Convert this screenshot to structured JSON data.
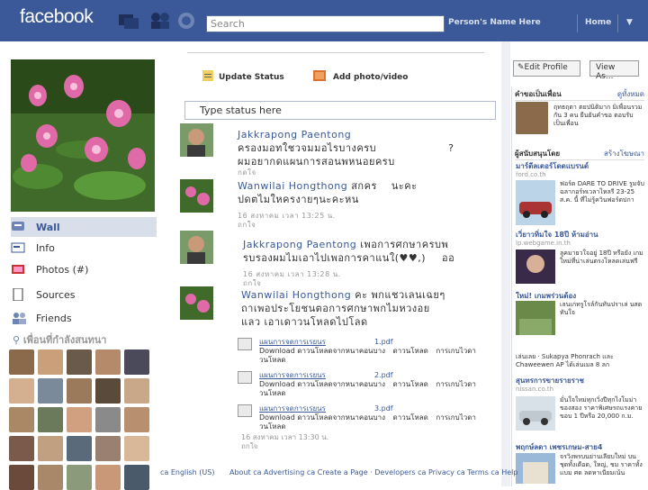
{
  "header": {
    "logo": "facebook",
    "search_placeholder": "Search",
    "user_name": "Person's Name Here",
    "home": "Home",
    "menu_arrow": "▼"
  },
  "profile": {
    "edit_profile": "Edit Profile",
    "view_as": "View As..."
  },
  "nav": {
    "items": [
      {
        "label": "Wall",
        "icon": "wall-icon"
      },
      {
        "label": "Info",
        "icon": "info-icon"
      },
      {
        "label": "Photos (#)",
        "icon": "photos-icon"
      },
      {
        "label": "Sources",
        "icon": "sources-icon"
      },
      {
        "label": "Friends",
        "icon": "friends-icon"
      }
    ],
    "friends_title": "เพื่อนที่กำลังสนทนา"
  },
  "publisher": {
    "update_status": "Update Status",
    "add_photo": "Add photo/video",
    "status_placeholder": "Type status here"
  },
  "posts": [
    {
      "author": "Jakkrapong Paentong",
      "line1": "ครองมอทใชวจมมอไรบางครบ",
      "line1b": "?",
      "line2": "ผมอยากดแผนการสอนพหนอยครบ",
      "meta": "กดใจ"
    },
    {
      "author": "Wanwilai Hongthong",
      "text1": "สกคร",
      "text1b": "นะคะ",
      "line2": "ปดตไมใหครงายๆนะคะหน",
      "meta": "16 สงหาคม เวลา 13:25 น.",
      "meta2": "ถกใจ"
    },
    {
      "author": "Jakkrapong Paentong",
      "text1": "เพอการศกษาครบพ",
      "line2": "รบรองผมไมเอาไปเพอการคาแนใ(♥♥,)",
      "line2b": "ออ",
      "meta": "16 สงหาคม เวลา 13:28 น.",
      "meta2": "ถกใจ"
    },
    {
      "author": "Wanwilai Hongthong",
      "text1": "คะ พกแชวเลนเฉยๆ",
      "line2": "ถาเพอประโยชนตอการศกษาพกไมหวงอย",
      "line3": "แลว เอาเดาวนโหลดไปโลด",
      "meta": "16 สงหาคม เวลา 13:30 น.",
      "meta2": "ถกใจ"
    }
  ],
  "files": [
    {
      "name": "แผนการจดการเรยนร",
      "suffix": "1.pdf",
      "download": "Download",
      "from": "ดาวนโหลดจากหนาคอนบาง",
      "link": "ดาวนโหลด",
      "sep": "การเกบไวดาวนโหลด"
    },
    {
      "name": "แผนการจดการเรยนร",
      "suffix": "2.pdf",
      "download": "Download",
      "from": "ดาวนโหลดจากหนาคอนบาง",
      "link": "ดาวนโหลด",
      "sep": "การเกบไวดาวนโหลด"
    },
    {
      "name": "แผนการจดการเรยนร",
      "suffix": "3.pdf",
      "download": "Download",
      "from": "ดาวนโหลดจากหนาคอนบาง",
      "link": "ดาวนโหลด",
      "sep": "การเกบไวดาวนโหลด"
    }
  ],
  "rightcol": {
    "head1": "คำขอเป็นเพื่อน",
    "head1_more": "ดูทั้งหมด",
    "req_text": "ฤทธฤตา ตยปนิติมาก มิเพื่อนรวมกัน 3 คน ยืนยันคำขอ ตอบรับเป็นเพื่อน",
    "head2": "ผู้สนับสนุนโดย",
    "head2_more": "สร้างโฆษณา",
    "ad1_title": "มาร์ตีลเตอร์โดดแบรนด์",
    "ad1_url": "ford.co.th",
    "ad1_text": "ฟอร์ด DARE TO DRIVE รูมจับฉลากอร์ทเวลาไหลรี 23-25 ส.ค. นี้ ที่ไม่รู้ควินฟอร์ดปกา",
    "ad2_title": "เวิ่ยาวทิ่มใจ 18ปี ห้ามอ่าน",
    "ad2_url": "lp.webgame.in.th",
    "ad2_text": "ลูคมายวใจอยู่ 18ปี หรือยัง เกมใหม่ที่น่าเล่นตรงโหลดเล่นฟรี",
    "ad3_title": "ใหม่! เกมพร่วนต้อง",
    "ad3_text": "เลนเกทรูโรล์กันทันปราเล่ นสดทันใจ",
    "ad4_text": "เล่นเลย · Sukapya Phonrach และ Chaweewen AP ได้เล่นเมล 8 ลก",
    "ad5_title": "สุนทรการขายรายราช",
    "ad5_url": "nissan.co.th",
    "ad5_text": "มั่นใจใหม่ทุกเวิ่งปีทุกไงโมม่าของสอง ราคาพิเศษรถแรงคาย ขอบ 1 ปีหรือ 20,000 ก.ม.",
    "ad6_title": "พฤกษ์ลดา เพชรเกษม-สาย4",
    "ad6_text": "จรวิงพรบนย่านเลียบใหม่ บนชุดทั้งเดือด, ใหญ่, ชม ราคาทั้งแบม ศด ลดหาเนียมเน้น"
  },
  "footer": {
    "lang": "ca English (US)",
    "links": "About ca Advertising ca Create a Page · Developers ca Privacy ca Terms ca Help"
  }
}
